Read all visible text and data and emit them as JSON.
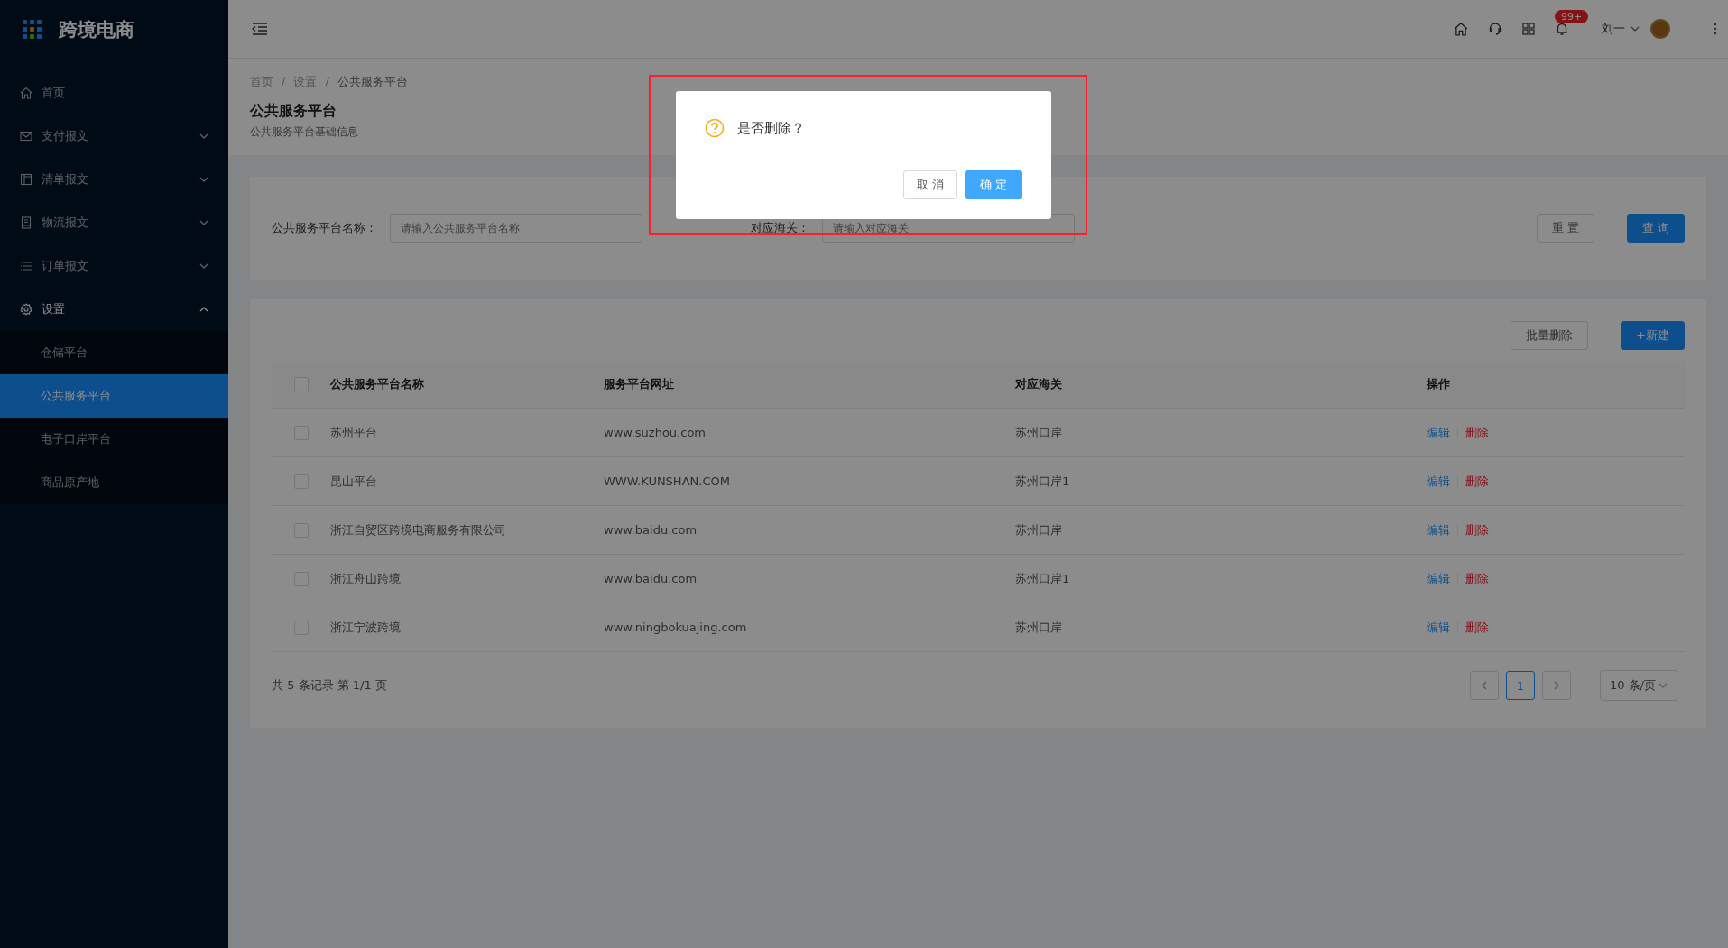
{
  "app": {
    "title": "跨境电商"
  },
  "sidebar": {
    "items": [
      {
        "kind": "link",
        "label": "首页",
        "selected": false
      },
      {
        "kind": "group",
        "label": "支付报文",
        "expanded": false
      },
      {
        "kind": "group",
        "label": "清单报文",
        "expanded": false
      },
      {
        "kind": "group",
        "label": "物流报文",
        "expanded": false
      },
      {
        "kind": "group",
        "label": "订单报文",
        "expanded": false
      },
      {
        "kind": "group",
        "label": "设置",
        "expanded": true,
        "children": [
          {
            "label": "仓储平台",
            "selected": false
          },
          {
            "label": "公共服务平台",
            "selected": true
          },
          {
            "label": "电子口岸平台",
            "selected": false
          },
          {
            "label": "商品原产地",
            "selected": false
          }
        ]
      }
    ]
  },
  "topbar": {
    "notification_badge": "99+",
    "user_name": "刘一"
  },
  "breadcrumb": [
    "首页",
    "设置",
    "公共服务平台"
  ],
  "breadcrumb_separator": "/",
  "page_header": {
    "title": "公共服务平台",
    "subtitle": "公共服务平台基础信息"
  },
  "filters": [
    {
      "label": "公共服务平台名称：",
      "placeholder": "请输入公共服务平台名称"
    },
    {
      "label": "对应海关：",
      "placeholder": "请输入对应海关"
    }
  ],
  "filter_buttons": {
    "reset": "重 置",
    "query": "查 询"
  },
  "table_actions": {
    "batch_delete": "批量删除",
    "create": "+新建"
  },
  "table": {
    "header_checked": false,
    "columns": [
      "公共服务平台名称",
      "服务平台网址",
      "对应海关",
      "操作"
    ],
    "rows": [
      {
        "checked": false,
        "name": "苏州平台",
        "url": "www.suzhou.com",
        "customs": "苏州口岸",
        "edit": "编辑",
        "delete": "删除"
      },
      {
        "checked": false,
        "name": "昆山平台",
        "url": "WWW.KUNSHAN.COM",
        "customs": "苏州口岸1",
        "edit": "编辑",
        "delete": "删除"
      },
      {
        "checked": false,
        "name": "浙江自贸区跨境电商服务有限公司",
        "url": "www.baidu.com",
        "customs": "苏州口岸",
        "edit": "编辑",
        "delete": "删除"
      },
      {
        "checked": false,
        "name": "浙江舟山跨境",
        "url": "www.baidu.com",
        "customs": "苏州口岸1",
        "edit": "编辑",
        "delete": "删除"
      },
      {
        "checked": false,
        "name": "浙江宁波跨境",
        "url": "www.ningbokuajing.com",
        "customs": "苏州口岸",
        "edit": "编辑",
        "delete": "删除"
      }
    ]
  },
  "footer_summary": "共 5 条记录 第 1/1 页",
  "pagination": {
    "pages": [
      {
        "label": "1",
        "selected": true
      }
    ],
    "page_size": "10 条/页"
  },
  "dialog": {
    "message": "是否删除？",
    "cancel": "取 消",
    "confirm": "确 定"
  }
}
